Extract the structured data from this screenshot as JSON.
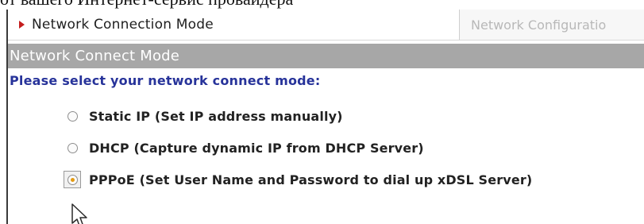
{
  "caption": {
    "text": "от вашего Интернет-сервис провайдера"
  },
  "tabs": {
    "active": {
      "label": "Network Connection Mode",
      "arrow_color": "#c41e1e"
    },
    "inactive": {
      "label": "Network Configuratio"
    }
  },
  "section": {
    "title": "Network Connect Mode",
    "background": "#a7a7a7"
  },
  "form": {
    "prompt": "Please select your network connect mode:",
    "prompt_color": "#27339a",
    "options": [
      {
        "label": "Static IP (Set IP address manually)",
        "checked": false
      },
      {
        "label": "DHCP (Capture dynamic IP from DHCP Server)",
        "checked": false
      },
      {
        "label": "PPPoE (Set User Name and Password to dial up xDSL Server)",
        "checked": true
      }
    ]
  },
  "icons": {
    "tab_marker": "red-triangle-arrow-icon",
    "cursor": "mouse-pointer-icon"
  }
}
